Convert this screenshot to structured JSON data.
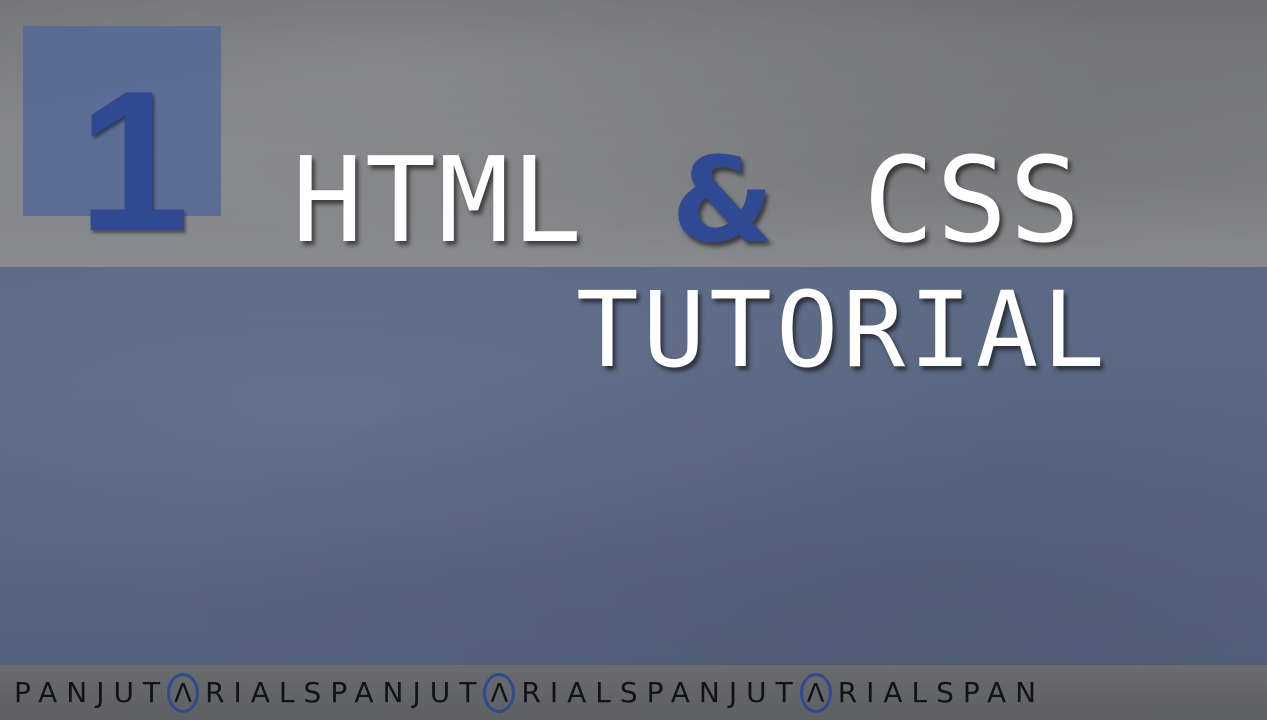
{
  "number": "1",
  "title": {
    "line1_left": "HTML",
    "ampersand": "&",
    "line1_right": "CSS",
    "line2": "TUTORIAL"
  },
  "footer": {
    "segments": [
      {
        "pre": "PANJUT",
        "ring": "Λ",
        "post": "RIALS"
      },
      {
        "pre": "PANJUT",
        "ring": "Λ",
        "post": "RIALS"
      },
      {
        "pre": "PANJUT",
        "ring": "Λ",
        "post": "RIALSPAN"
      }
    ]
  },
  "colors": {
    "accent": "#2f4a93",
    "band": "#5a6683",
    "background": "#7d7f83",
    "text": "#ffffff"
  }
}
